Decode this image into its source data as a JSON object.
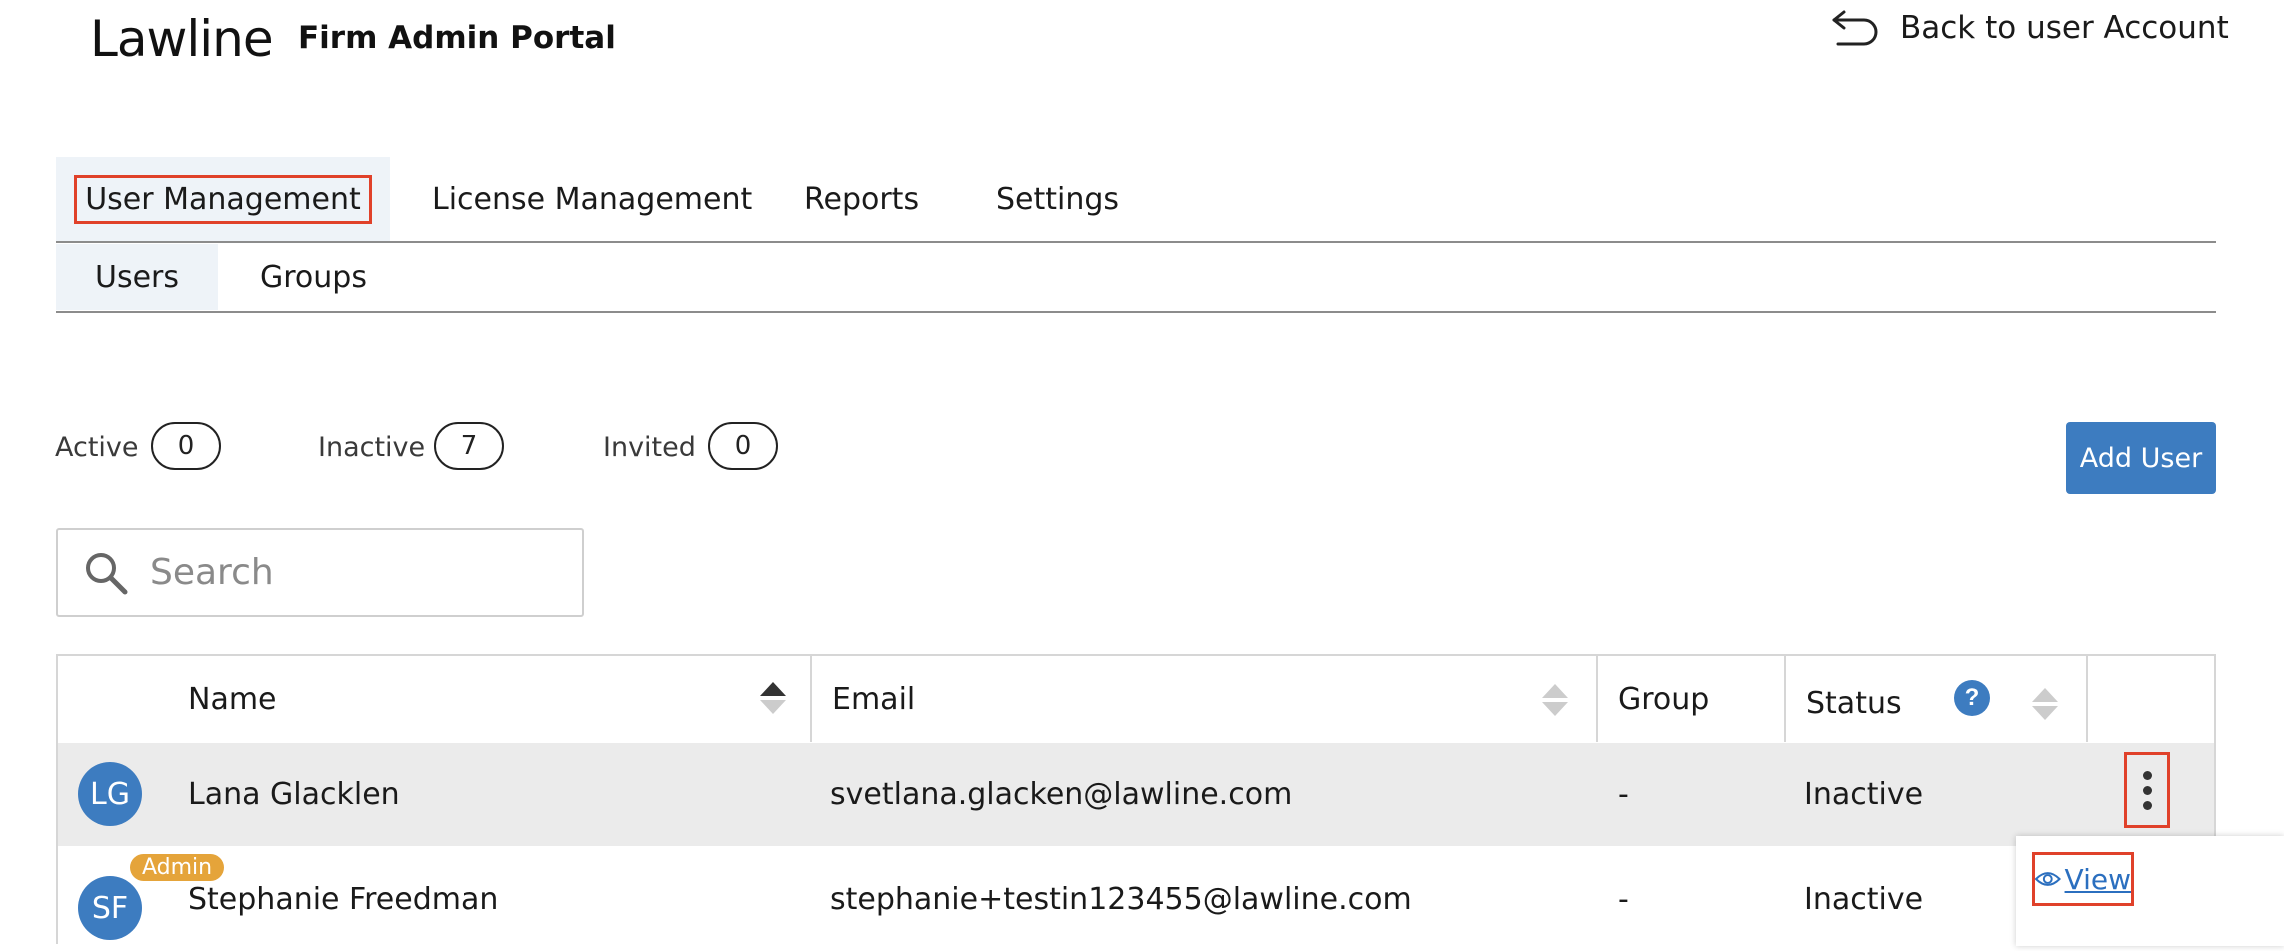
{
  "header": {
    "logo_text": "Lawline",
    "portal_title": "Firm Admin Portal",
    "back_link": "Back to user Account",
    "back_icon": "undo-arrow-icon"
  },
  "primary_tabs": [
    {
      "label": "User Management",
      "active": true
    },
    {
      "label": "License Management",
      "active": false
    },
    {
      "label": "Reports",
      "active": false
    },
    {
      "label": "Settings",
      "active": false
    }
  ],
  "sub_tabs": [
    {
      "label": "Users",
      "active": true
    },
    {
      "label": "Groups",
      "active": false
    }
  ],
  "counters": [
    {
      "label": "Active",
      "value": "0"
    },
    {
      "label": "Inactive",
      "value": "7"
    },
    {
      "label": "Invited",
      "value": "0"
    }
  ],
  "add_user_label": "Add User",
  "search": {
    "placeholder": "Search",
    "value": ""
  },
  "table": {
    "columns": [
      "Name",
      "Email",
      "Group",
      "Status"
    ],
    "status_help_label": "?",
    "rows": [
      {
        "initials": "LG",
        "name": "Lana Glacklen",
        "email": "svetlana.glacken@lawline.com",
        "group": "-",
        "status": "Inactive",
        "badge": ""
      },
      {
        "initials": "SF",
        "name": "Stephanie Freedman",
        "email": "stephanie+testin123455@lawline.com",
        "group": "-",
        "status": "Inactive",
        "badge": "Admin"
      }
    ]
  },
  "row_menu": {
    "view_label": "View"
  },
  "colors": {
    "accent": "#3d7cc0",
    "highlight_box": "#e0412a",
    "admin_badge": "#e5a43a",
    "selected_row": "#ebebeb",
    "active_tab_bg": "#eef3f8"
  }
}
